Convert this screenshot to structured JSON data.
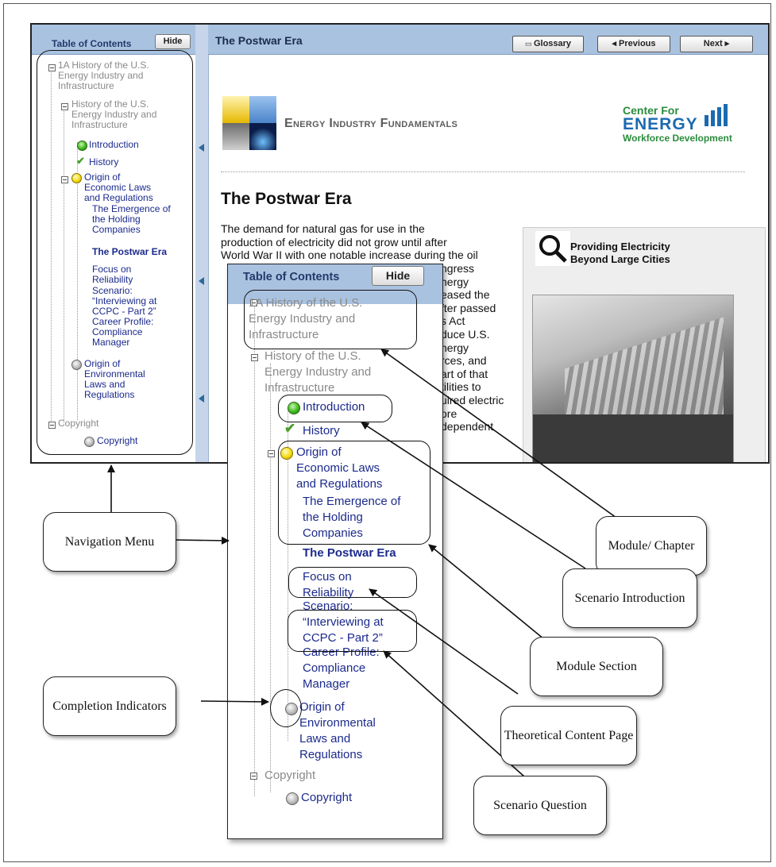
{
  "window": {
    "toc_title": "Table of Contents",
    "hide_label": "Hide",
    "page_title": "The Postwar Era",
    "glossary_label": "Glossary",
    "previous_label": "◂ Previous",
    "next_label": "Next ▸"
  },
  "toc": {
    "module": "1A History of the U.S. Energy Industry and Infrastructure",
    "module_l1": "1A History of the U.S.",
    "module_l2": "Energy Industry and",
    "module_l3": "Infrastructure",
    "section": "History of the U.S. Energy Industry and Infrastructure",
    "section_l1": "History of the U.S.",
    "section_l2": "Energy Industry and",
    "section_l3": "Infrastructure",
    "intro": "Introduction",
    "history": "History",
    "origin_l1": "Origin of",
    "origin_l2": "Economic Laws",
    "origin_l3": "and Regulations",
    "emergence_l1": "The Emergence of",
    "emergence_l2": "the Holding",
    "emergence_l3": "Companies",
    "postwar": "The Postwar Era",
    "focus_l1": "Focus on",
    "focus_l2": "Reliability",
    "scenario_l1": "Scenario:",
    "scenario_l2": "“Interviewing at",
    "scenario_l3": "CCPC - Part 2”",
    "career_l1": "Career Profile:",
    "career_l2": "Compliance",
    "career_l3": "Manager",
    "env_l1": "Origin of",
    "env_l2": "Environmental",
    "env_l3": "Laws and",
    "env_l4": "Regulations",
    "copyright_group": "Copyright",
    "copyright_item": "Copyright"
  },
  "zoom_toc": {
    "module_l2": "Energy Industry and",
    "module_l1": "1A History of the U.S.",
    "origin_l2": "Economic Laws and Regulations",
    "emergence": "The Emergence of the Holding Companies",
    "focus": "Focus on Reliability",
    "scenario": "Scenario: “Interviewing at CCPC - Part 2”",
    "career": "Career Profile: Compliance Manager",
    "env": "Origin of Environmental Laws and Regulations"
  },
  "content": {
    "banner": "Energy Industry Fundamentals",
    "logo_l1": "Center For",
    "logo_l2": "ENERGY",
    "logo_l3": "Workforce Development",
    "heading": "The Postwar Era",
    "para_l1": "The demand for natural gas for use in the",
    "para_l2": "production of electricity did not grow until after",
    "para_l3": "World War II with one notable increase during the oil",
    "sidebar_title_l1": "Providing Electricity",
    "sidebar_title_l2": "Beyond Large Cities",
    "frag_r1": "ngress",
    "frag_r2": "nergy",
    "frag_r3": "eased the",
    "frag_r4": "fter passed",
    "frag_r5": "s Act",
    "frag_r6": "duce U.S.",
    "frag_r7": "nergy",
    "frag_r8": "rces, and",
    "frag_r9": "art of that",
    "frag_r10": "tilities to",
    "frag_r11": "uired electric",
    "frag_r12": "ore",
    "frag_r13": "dependent"
  },
  "callouts": {
    "navigation": "Navigation Menu",
    "completion": "Completion Indicators",
    "module": "Module/ Chapter",
    "scenario_intro": "Scenario Introduction",
    "module_section": "Module Section",
    "theoretical": "Theoretical Content Page",
    "scenario_question": "Scenario Question"
  }
}
